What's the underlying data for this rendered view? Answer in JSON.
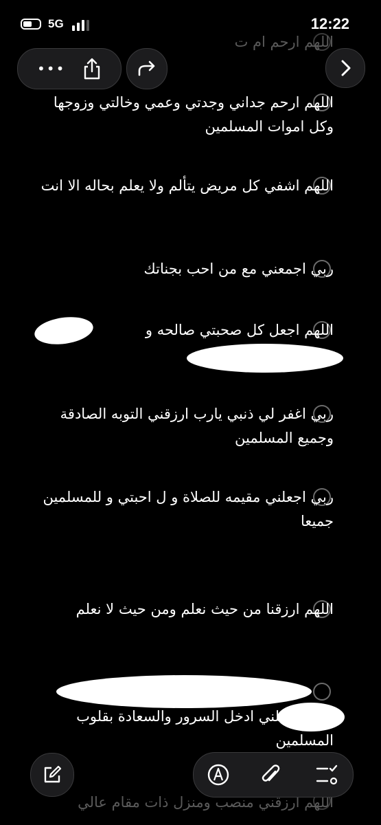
{
  "status": {
    "network": "5G",
    "time": "12:22"
  },
  "top_toolbar": {
    "more_icon": "ellipsis-icon",
    "share_icon": "share-icon",
    "forward_icon": "forward-arrow-icon",
    "next_icon": "chevron-right-icon"
  },
  "items": [
    {
      "text": "اللهم ارحم  ام ت",
      "partial": true
    },
    {
      "text": "اللهم ارحم جداني وجدتي وعمي وخالتي وزوجها وكل اموات المسلمين"
    },
    {
      "text": "اللهم اشفي كل مريض يتألم ولا يعلم بحاله الا انت"
    },
    {
      "text": "ربي اجمعني مع من احب بجناتك"
    },
    {
      "text": "اللهم اجعل كل صحبتي صالحه و",
      "redacted": true
    },
    {
      "text": "ربي اغفر لي ذنبي يارب ارزقني التوبه الصادقة وجميع المسلمين"
    },
    {
      "text": "ربي اجعلني مقيمه للصلاة و ل احبتي و للمسلمين جميعا"
    },
    {
      "text": "اللهم ارزقنا من حيث نعلم ومن حيث لا نعلم"
    },
    {
      "text": "اللهم اجعلني ادخل السرور والسعادة بقلوب المسلمين",
      "redacted": true
    },
    {
      "text": "اللهم ارزقني منصب ومنزل ذات مقام عالي",
      "partial": true
    }
  ],
  "bottom_toolbar": {
    "compose_icon": "compose-icon",
    "markup_icon": "markup-pen-icon",
    "attach_icon": "paperclip-icon",
    "checklist_icon": "checklist-icon"
  }
}
